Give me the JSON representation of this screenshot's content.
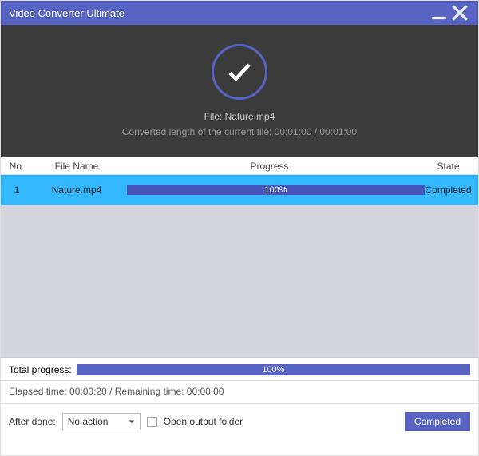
{
  "titlebar": {
    "title": "Video Converter Ultimate"
  },
  "header": {
    "file_label": "File: Nature.mp4",
    "converted_label": "Converted length of the current file: 00:01:00 / 00:01:00"
  },
  "table": {
    "headers": {
      "no": "No.",
      "file_name": "File Name",
      "progress": "Progress",
      "state": "State"
    },
    "rows": [
      {
        "no": "1",
        "file_name": "Nature.mp4",
        "progress_text": "100%",
        "state": "Completed"
      }
    ]
  },
  "total": {
    "label": "Total progress:",
    "percent_text": "100%"
  },
  "time": {
    "elapsed_remaining": "Elapsed time: 00:00:20 / Remaining time: 00:00:00"
  },
  "footer": {
    "after_done_label": "After done:",
    "after_done_selected": "No action",
    "open_output_label": "Open output folder",
    "completed_button": "Completed"
  }
}
